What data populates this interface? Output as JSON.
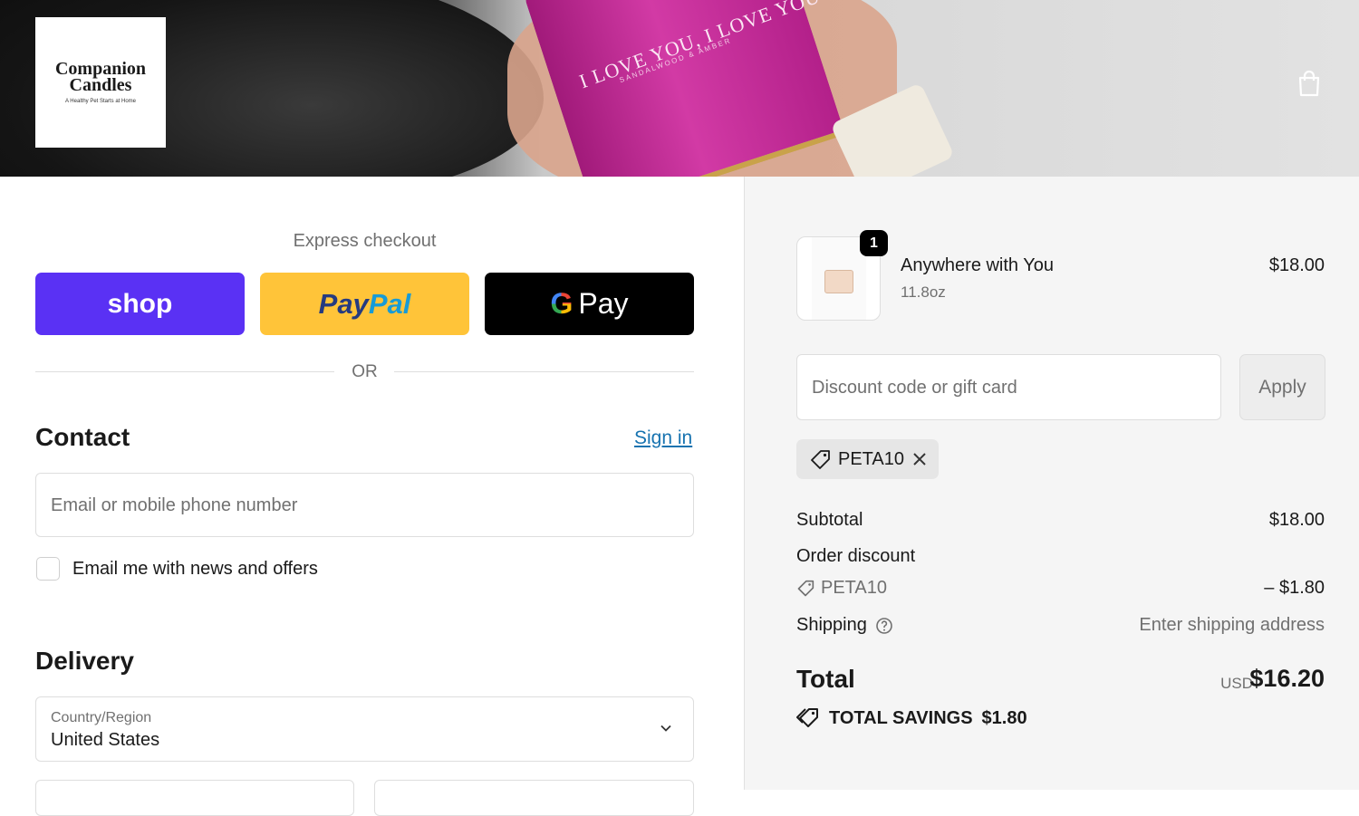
{
  "header": {
    "logo_line1": "Companion",
    "logo_line2": "Candles",
    "logo_tagline": "A Healthy Pet Starts at Home",
    "banner_text": "I LOVE YOU, I LOVE YOU",
    "banner_subtext": "SANDALWOOD & AMBER",
    "cart_icon": "shopping-bag-icon"
  },
  "express": {
    "label": "Express checkout",
    "shop_label": "shop",
    "paypal_label_1": "Pay",
    "paypal_label_2": "Pal",
    "gpay_g": "G",
    "gpay_label": "Pay",
    "or_label": "OR"
  },
  "contact": {
    "heading": "Contact",
    "signin": "Sign in",
    "email_placeholder": "Email or mobile phone number",
    "newsletter_label": "Email me with news and offers"
  },
  "delivery": {
    "heading": "Delivery",
    "country_label": "Country/Region",
    "country_value": "United States"
  },
  "summary": {
    "item": {
      "quantity": "1",
      "name": "Anywhere with You",
      "variant": "11.8oz",
      "price": "$18.00"
    },
    "discount_placeholder": "Discount code or gift card",
    "apply_label": "Apply",
    "applied_code": "PETA10",
    "subtotal_label": "Subtotal",
    "subtotal_value": "$18.00",
    "order_discount_label": "Order discount",
    "discount_code": "PETA10",
    "discount_value": "– $1.80",
    "shipping_label": "Shipping",
    "shipping_value": "Enter shipping address",
    "total_label": "Total",
    "currency": "USD",
    "total_value": "$16.20",
    "savings_label": "TOTAL SAVINGS",
    "savings_value": "$1.80"
  },
  "colors": {
    "shop": "#5a31f4",
    "paypal": "#ffc439",
    "gpay": "#000000",
    "link": "#1773b0"
  }
}
